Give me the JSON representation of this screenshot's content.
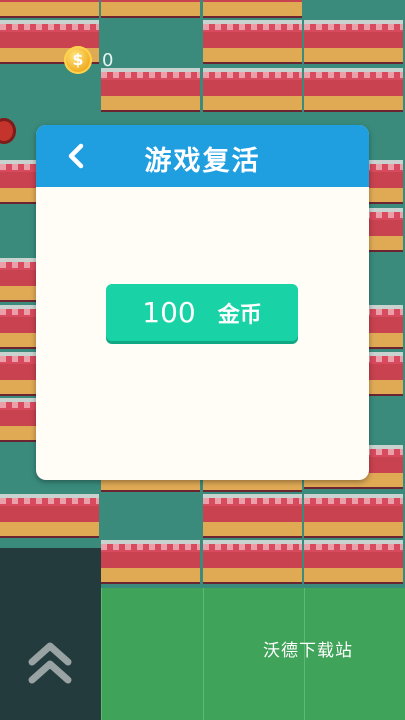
{
  "hud": {
    "coins": "0",
    "coin_symbol": "$"
  },
  "dialog": {
    "title": "游戏复活",
    "buy_amount": "100",
    "buy_unit": "金币"
  },
  "watermark": "沃德下载站",
  "colors": {
    "background": "#3a8b7c",
    "header": "#1f9ee0",
    "button": "#19d3a6",
    "dialog_body": "#fffdf5",
    "floor_green": "#40a35a"
  }
}
